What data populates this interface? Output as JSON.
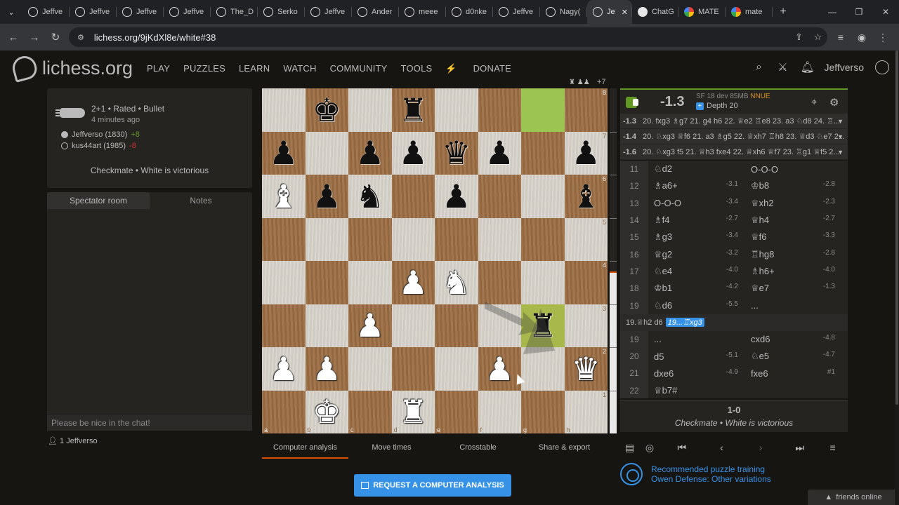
{
  "browser": {
    "tabs": [
      {
        "label": "Jeffve"
      },
      {
        "label": "Jeffve"
      },
      {
        "label": "Jeffve"
      },
      {
        "label": "Jeffve"
      },
      {
        "label": "The_D"
      },
      {
        "label": "Serko"
      },
      {
        "label": "Jeffve"
      },
      {
        "label": "Ander"
      },
      {
        "label": "meee"
      },
      {
        "label": "d0nke"
      },
      {
        "label": "Jeffve"
      },
      {
        "label": "Nagy("
      },
      {
        "label": "Je"
      },
      {
        "label": "ChatG"
      },
      {
        "label": "MATE"
      },
      {
        "label": "mate"
      }
    ],
    "url": "lichess.org/9jKdXl8e/white#38"
  },
  "site": {
    "logo_name": "lichess",
    "logo_tld": ".org",
    "nav": [
      "PLAY",
      "PUZZLES",
      "LEARN",
      "WATCH",
      "COMMUNITY",
      "TOOLS"
    ],
    "donate": "DONATE",
    "username": "Jeffverso"
  },
  "game": {
    "title": "2+1 • Rated • Bullet",
    "time_ago": "4 minutes ago",
    "white_player": "Jeffverso (1830)",
    "white_diff": "+8",
    "black_player": "kus44art (1985)",
    "black_diff": "-8",
    "result_text": "Checkmate • White is victorious"
  },
  "chat": {
    "tab_room": "Spectator room",
    "tab_notes": "Notes",
    "placeholder": "Please be nice in the chat!",
    "spectator_count": "1",
    "spectator_name": "Jeffverso"
  },
  "board": {
    "material_diff": "+7",
    "files": [
      "a",
      "b",
      "c",
      "d",
      "e",
      "f",
      "g",
      "h"
    ],
    "ranks": [
      "8",
      "7",
      "6",
      "5",
      "4",
      "3",
      "2",
      "1"
    ],
    "squares": [
      [
        "",
        "bK",
        "",
        "bR",
        "",
        "",
        "hl",
        ""
      ],
      [
        "bP",
        "",
        "bP",
        "bP",
        "bQ",
        "bP",
        "",
        "bP"
      ],
      [
        "wB",
        "bP",
        "bN",
        "",
        "bP",
        "",
        "",
        "bB"
      ],
      [
        "",
        "",
        "",
        "",
        "",
        "",
        "",
        ""
      ],
      [
        "",
        "",
        "",
        "wP",
        "wN",
        "",
        "",
        ""
      ],
      [
        "",
        "",
        "wP",
        "",
        "",
        "",
        "bR",
        ""
      ],
      [
        "wP",
        "wP",
        "",
        "",
        "",
        "wP",
        "",
        "wQ"
      ],
      [
        "",
        "wK",
        "",
        "wR",
        "",
        "",
        "",
        ""
      ]
    ],
    "highlight_target": "g3"
  },
  "analysis_tabs": [
    "Computer analysis",
    "Move times",
    "Crosstable",
    "Share & export"
  ],
  "request_button": "REQUEST A COMPUTER ANALYSIS",
  "engine": {
    "score": "-1.3",
    "engine_name": "SF 18 dev 85MB",
    "nnue": "NNUE",
    "depth": "Depth 20",
    "white_bar_fraction": 0.47,
    "pv_lines": [
      {
        "score": "-1.3",
        "moves": "20. fxg3 ♗g7 21. g4 h6 22. ♕e2 ♖e8 23. a3 ♘d8 24. ♖..."
      },
      {
        "score": "-1.4",
        "moves": "20. ♘xg3 ♕f6 21. a3 ♗g5 22. ♕xh7 ♖h8 23. ♕d3 ♘e7 2..."
      },
      {
        "score": "-1.6",
        "moves": "20. ♘xg3 f5 21. ♕h3 fxe4 22. ♕xh6 ♕f7 23. ♖g1 ♕f5 2..."
      }
    ]
  },
  "moves": [
    {
      "num": "11",
      "white": "♘d2",
      "we": "",
      "black": "O-O-O",
      "be": ""
    },
    {
      "num": "12",
      "white": "♗a6+",
      "we": "-3.1",
      "black": "♔b8",
      "be": "-2.8"
    },
    {
      "num": "13",
      "white": "O-O-O",
      "we": "-3.4",
      "black": "♕xh2",
      "be": "-2.3"
    },
    {
      "num": "14",
      "white": "♗f4",
      "we": "-2.7",
      "black": "♕h4",
      "be": "-2.7"
    },
    {
      "num": "15",
      "white": "♗g3",
      "we": "-3.4",
      "black": "♕f6",
      "be": "-3.3"
    },
    {
      "num": "16",
      "white": "♕g2",
      "we": "-3.2",
      "black": "♖hg8",
      "be": "-2.8"
    },
    {
      "num": "17",
      "white": "♘e4",
      "we": "-4.0",
      "black": "♗h6+",
      "be": "-4.0"
    },
    {
      "num": "18",
      "white": "♔b1",
      "we": "-4.2",
      "black": "♕e7",
      "be": "-1.3"
    },
    {
      "num": "19",
      "white": "♘d6",
      "we": "-5.5",
      "black": "...",
      "be": ""
    }
  ],
  "variation": {
    "prefix": "19.♕h2 d6",
    "highlight": "19...♖xg3"
  },
  "moves_after": [
    {
      "num": "19",
      "white": "...",
      "we": "",
      "black": "cxd6",
      "be": "-4.8"
    },
    {
      "num": "20",
      "white": "d5",
      "we": "-5.1",
      "black": "♘e5",
      "be": "-4.7"
    },
    {
      "num": "21",
      "white": "dxe6",
      "we": "-4.9",
      "black": "fxe6",
      "be": "#1"
    },
    {
      "num": "22",
      "white": "♕b7#",
      "we": "",
      "black": "",
      "be": ""
    }
  ],
  "final": {
    "score": "1-0",
    "result": "Checkmate • White is victorious"
  },
  "puzzle": {
    "line1": "Recommended puzzle training",
    "line2": "Owen Defense: Other variations"
  },
  "friends": "friends online",
  "colors": {
    "accent_blue": "#3692e7",
    "win_green": "#629924",
    "donate": "#d59120",
    "hl_square": "#9bc453"
  }
}
